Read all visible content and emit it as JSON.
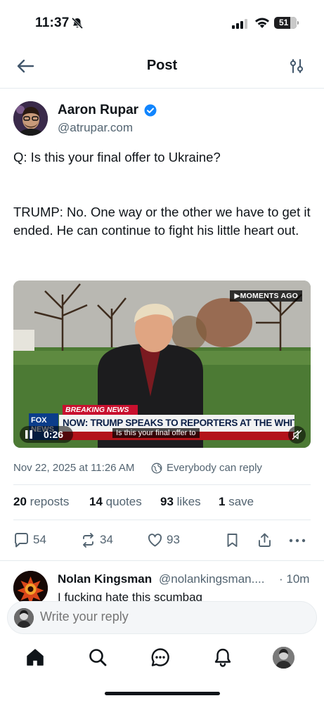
{
  "status_bar": {
    "time": "11:37",
    "battery": "51"
  },
  "nav": {
    "title": "Post"
  },
  "post": {
    "author_name": "Aaron Rupar",
    "author_handle": "@atrupar.com",
    "text": "Q: Is this your final offer to Ukraine?\n\n\nTRUMP: No. One way or the other we have to get it ended. He can continue to fight his little heart out.",
    "video": {
      "moments_ago": "▶MOMENTS AGO",
      "breaking_tag": "BREAKING NEWS",
      "headline": "NOW: TRUMP SPEAKS TO REPORTERS AT THE WHITE HOUSE",
      "network": "FOX NEWS",
      "caption": "Is this your final offer to",
      "time": "0:26"
    },
    "date": "Nov 22, 2025 at 11:26 AM",
    "reply_setting": "Everybody can reply",
    "stats": {
      "reposts_count": "20",
      "reposts_label": "reposts",
      "quotes_count": "14",
      "quotes_label": "quotes",
      "likes_count": "93",
      "likes_label": "likes",
      "saves_count": "1",
      "saves_label": "save"
    },
    "actions": {
      "replies": "54",
      "reposts": "34",
      "likes": "93"
    }
  },
  "reply": {
    "name": "Nolan Kingsman",
    "handle": "@nolankingsman....",
    "time": "· 10m",
    "text": "I fucking hate this scumbag"
  },
  "composer": {
    "placeholder": "Write your reply"
  },
  "colors": {
    "accent": "#1185fe",
    "muted": "#536471",
    "text": "#0f1419"
  },
  "tabs": [
    "home-icon",
    "search-icon",
    "chat-icon",
    "notifications-icon",
    "profile-avatar"
  ]
}
